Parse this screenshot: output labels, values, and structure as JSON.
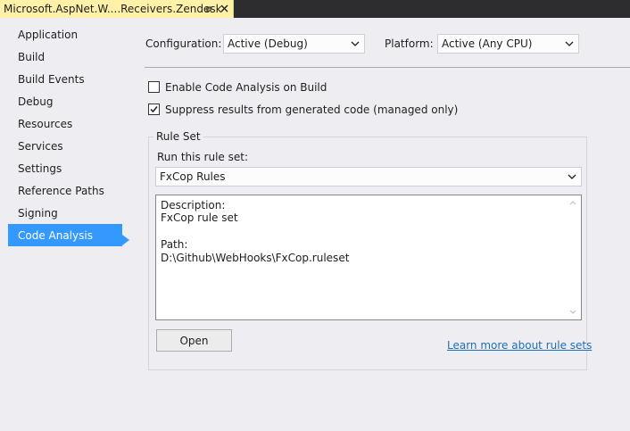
{
  "document_tab": {
    "title": "Microsoft.AspNet.W....Receivers.Zendesk",
    "pin_icon": "pin-icon",
    "close_icon": "close-icon"
  },
  "sidebar": {
    "items": [
      {
        "label": "Application",
        "active": false
      },
      {
        "label": "Build",
        "active": false
      },
      {
        "label": "Build Events",
        "active": false
      },
      {
        "label": "Debug",
        "active": false
      },
      {
        "label": "Resources",
        "active": false
      },
      {
        "label": "Services",
        "active": false
      },
      {
        "label": "Settings",
        "active": false
      },
      {
        "label": "Reference Paths",
        "active": false
      },
      {
        "label": "Signing",
        "active": false
      },
      {
        "label": "Code Analysis",
        "active": true
      }
    ],
    "active_color": "#3399ff"
  },
  "config": {
    "configuration_label": "Configuration:",
    "configuration_value": "Active (Debug)",
    "platform_label": "Platform:",
    "platform_value": "Active (Any CPU)"
  },
  "options": {
    "enable_code_analysis": {
      "label": "Enable Code Analysis on Build",
      "checked": false
    },
    "suppress_generated": {
      "label": "Suppress results from generated code (managed only)",
      "checked": true
    }
  },
  "rule_set": {
    "group_title": "Rule Set",
    "run_label": "Run this rule set:",
    "selected": "FxCop Rules",
    "description_heading": "Description:",
    "description_text": "FxCop rule set",
    "path_heading": "Path:",
    "path_text": "D:\\Github\\WebHooks\\FxCop.ruleset",
    "open_button": "Open",
    "learn_more_link": "Learn more about rule sets"
  }
}
